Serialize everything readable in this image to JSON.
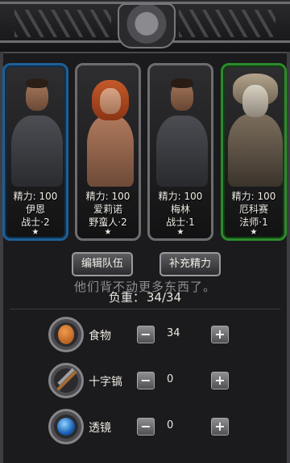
{
  "party": [
    {
      "energy_label": "精力: 100",
      "name": "伊恩",
      "class_level": "战士·2",
      "star": "★",
      "frame": "blue"
    },
    {
      "energy_label": "精力: 100",
      "name": "爱莉诺",
      "class_level": "野蛮人·2",
      "star": "★",
      "frame": "gray"
    },
    {
      "energy_label": "精力: 100",
      "name": "梅林",
      "class_level": "战士·1",
      "star": "★",
      "frame": "gray"
    },
    {
      "energy_label": "精力: 100",
      "name": "厄科赛",
      "class_level": "法师·1",
      "star": "★",
      "frame": "green"
    }
  ],
  "buttons": {
    "edit_team": "编辑队伍",
    "restore_energy": "补充精力"
  },
  "message": "他们背不动更多东西了。",
  "weight": {
    "label": "负重：",
    "value": "34/34"
  },
  "supplies": [
    {
      "name": "食物",
      "qty": "34",
      "icon": "food-icon"
    },
    {
      "name": "十字镐",
      "qty": "0",
      "icon": "pickaxe-icon"
    },
    {
      "name": "透镜",
      "qty": "0",
      "icon": "lens-icon"
    }
  ],
  "controls": {
    "minus": "−",
    "plus": "+"
  },
  "colors": {
    "frame_blue": "#1f5f94",
    "frame_green": "#2c8a2c",
    "frame_gray": "#6d6d70"
  }
}
